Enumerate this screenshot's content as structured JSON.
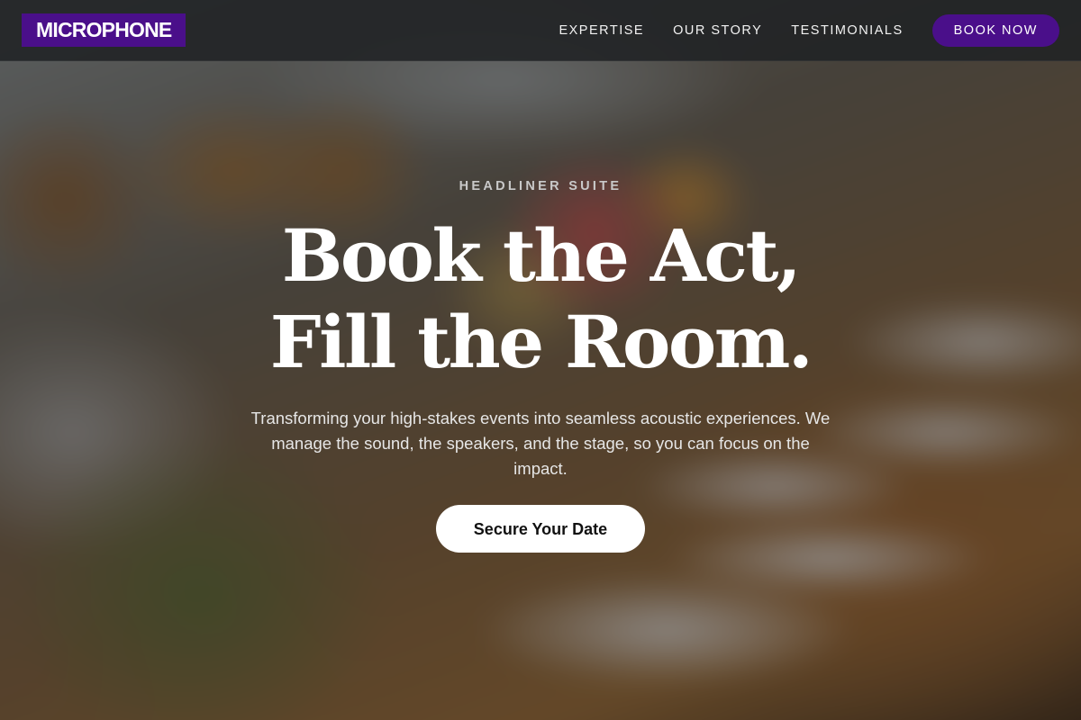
{
  "navbar": {
    "logo": "MICROPHONE",
    "links": [
      "EXPERTISE",
      "OUR STORY",
      "TESTIMONIALS"
    ],
    "book_label": "BOOK NOW"
  },
  "hero": {
    "eyebrow": "HEADLINER SUITE",
    "headline_line1": "Book the Act,",
    "headline_line2": "Fill the Room.",
    "subtext": "Transforming your high-stakes events into seamless acoustic experiences. We manage the sound, the speakers, and the stage, so you can focus on the impact.",
    "cta_label": "Secure Your Date",
    "background_image": "blurred banquet table with floral centerpiece"
  },
  "colors": {
    "brand_purple": "#4a0f8a",
    "nav_background": "#202224",
    "cta_background": "#ffffff",
    "headline_text": "#ffffff"
  }
}
